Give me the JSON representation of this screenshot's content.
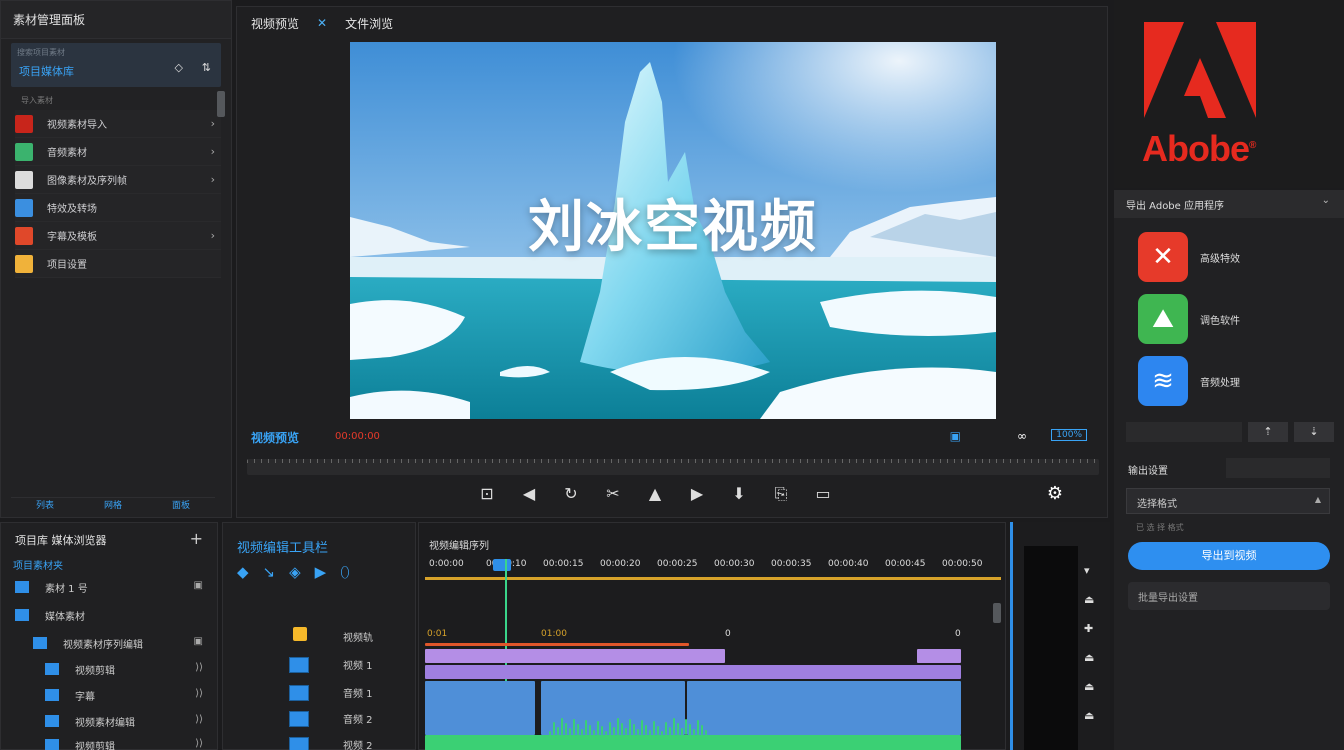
{
  "left_panel": {
    "title": "素材管理面板",
    "search": {
      "hint": "搜索项目素材",
      "label": "项目媒体库",
      "icon_a": "◇",
      "icon_b": "⇅"
    },
    "section_label": "导入素材",
    "items": [
      {
        "label": "视频素材导入",
        "icon": "adobe-app-icon",
        "color": "#c8251b",
        "chevron": "›"
      },
      {
        "label": "音频素材",
        "icon": "layers-icon",
        "color": "#3bb36e",
        "chevron": "›"
      },
      {
        "label": "图像素材及序列帧",
        "icon": "document-icon",
        "color": "#dcdcdc",
        "chevron": "›"
      },
      {
        "label": "特效及转场",
        "icon": "cube-icon",
        "color": "#3b8fe0",
        "chevron": ""
      },
      {
        "label": "字幕及模板",
        "icon": "media-icon",
        "color": "#e0482a",
        "chevron": "›"
      },
      {
        "label": "项目设置",
        "icon": "grid-icon",
        "color": "#f0b23a",
        "chevron": ""
      }
    ],
    "footer": [
      "列表",
      "网格",
      "面板"
    ]
  },
  "preview": {
    "tabs": [
      "视频预览",
      "文件浏览"
    ],
    "tab_sep": "✕",
    "title_overlay": "刘冰空视频",
    "bottom_label": "视频预览",
    "timecode": "00:00:00",
    "loop_icon": "∞",
    "zoom": "100%",
    "ruler_text": "1 00 01 02 03 04 05",
    "tools": [
      "⊡",
      "◀",
      "↻",
      "✂",
      "▲",
      "▶",
      "⬇",
      "⎘",
      "▭"
    ]
  },
  "adobe": {
    "wordmark": "Abobe",
    "reg": "®",
    "brand_color": "#e62a1f"
  },
  "right_panel": {
    "title": "导出 Adobe 应用程序",
    "chevron": "⌄",
    "apps": [
      {
        "label": "高级特效",
        "icon": "premiere-icon",
        "glyph": "✕",
        "color": "#e63a2a"
      },
      {
        "label": "调色软件",
        "icon": "photo-icon",
        "glyph": "⛰",
        "color": "#3fb651"
      },
      {
        "label": "音频处理",
        "icon": "audition-icon",
        "glyph": "≋",
        "color": "#2d86f0"
      }
    ],
    "btn_up": "⇡",
    "btn_down": "⇣",
    "format_label": "输出设置",
    "select_value": "选择格式",
    "select_hint": "已 选 择 格式",
    "primary_button": "导出到视频",
    "secondary_button": "批量导出设置"
  },
  "bottom_left": {
    "title": "项目库  媒体浏览器",
    "plus": "+",
    "tab": "项目素材夹",
    "rows": [
      {
        "label": "素材 1 号",
        "extra": "▣"
      },
      {
        "label": "媒体素材",
        "extra": ""
      },
      {
        "label": "视频素材序列编辑",
        "extra": "▣"
      },
      {
        "label": "视频剪辑",
        "extra": "⟩⟩"
      },
      {
        "label": "字幕",
        "extra": "⟩⟩"
      },
      {
        "label": "视频素材编辑",
        "extra": "⟩⟩"
      },
      {
        "label": "视频剪辑",
        "extra": "⟩⟩"
      }
    ]
  },
  "tracks": {
    "title": "视频编辑工具栏",
    "tools": [
      "◆",
      "↘",
      "◈",
      "▶",
      "⬯"
    ],
    "rows": [
      {
        "label": "视频轨"
      },
      {
        "label": "视频 1"
      },
      {
        "label": "音频 1"
      },
      {
        "label": "音频 2"
      },
      {
        "label": "视频 2"
      }
    ]
  },
  "timeline": {
    "title": "视频编辑序列",
    "ruler": [
      "0:00:00",
      "00:00:10",
      "00:00:15",
      "00:00:20",
      "00:00:25",
      "00:00:30",
      "00:00:35",
      "00:00:40",
      "00:00:45",
      "00:00:50"
    ],
    "markers": [
      "0:01",
      "01:00",
      "0",
      "0"
    ],
    "colors": {
      "purple": "#b48ee6",
      "blue": "#4f8fd8",
      "green": "#3bd074",
      "gold": "#d6a22a"
    }
  },
  "timeline_right": {
    "icons": [
      "▾",
      "⏏",
      "✚",
      "⏏",
      "⏏",
      "⏏"
    ]
  }
}
